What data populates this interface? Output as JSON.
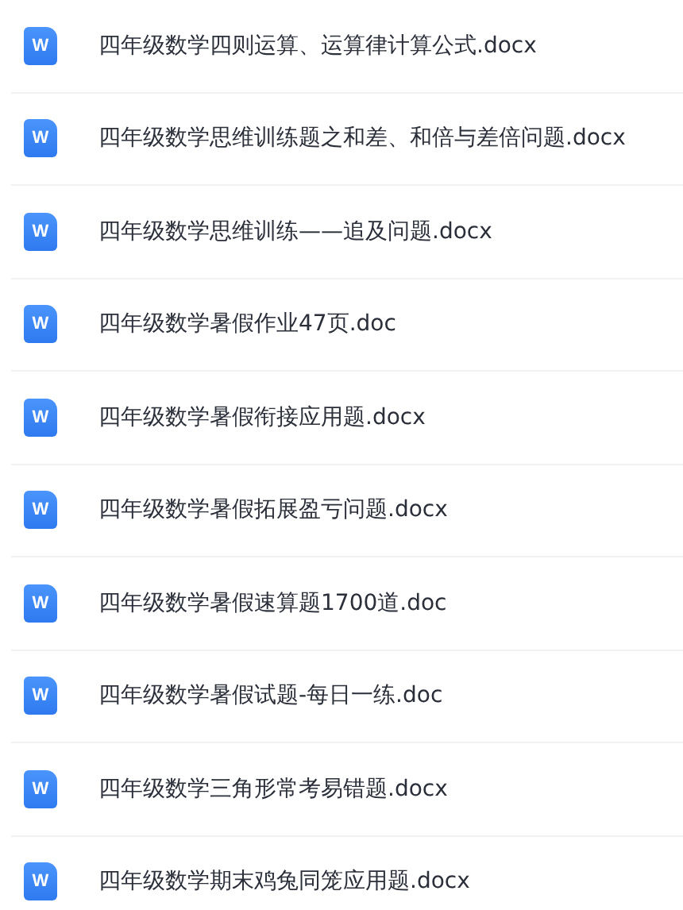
{
  "files": [
    {
      "name": "四年级数学四则运算、运算律计算公式.docx",
      "icon_letter": "W"
    },
    {
      "name": "四年级数学思维训练题之和差、和倍与差倍问题.docx",
      "icon_letter": "W"
    },
    {
      "name": "四年级数学思维训练——追及问题.docx",
      "icon_letter": "W"
    },
    {
      "name": "四年级数学暑假作业47页.doc",
      "icon_letter": "W"
    },
    {
      "name": "四年级数学暑假衔接应用题.docx",
      "icon_letter": "W"
    },
    {
      "name": "四年级数学暑假拓展盈亏问题.docx",
      "icon_letter": "W"
    },
    {
      "name": "四年级数学暑假速算题1700道.doc",
      "icon_letter": "W"
    },
    {
      "name": "四年级数学暑假试题-每日一练.doc",
      "icon_letter": "W"
    },
    {
      "name": "四年级数学三角形常考易错题.docx",
      "icon_letter": "W"
    },
    {
      "name": "四年级数学期末鸡兔同笼应用题.docx",
      "icon_letter": "W"
    }
  ]
}
